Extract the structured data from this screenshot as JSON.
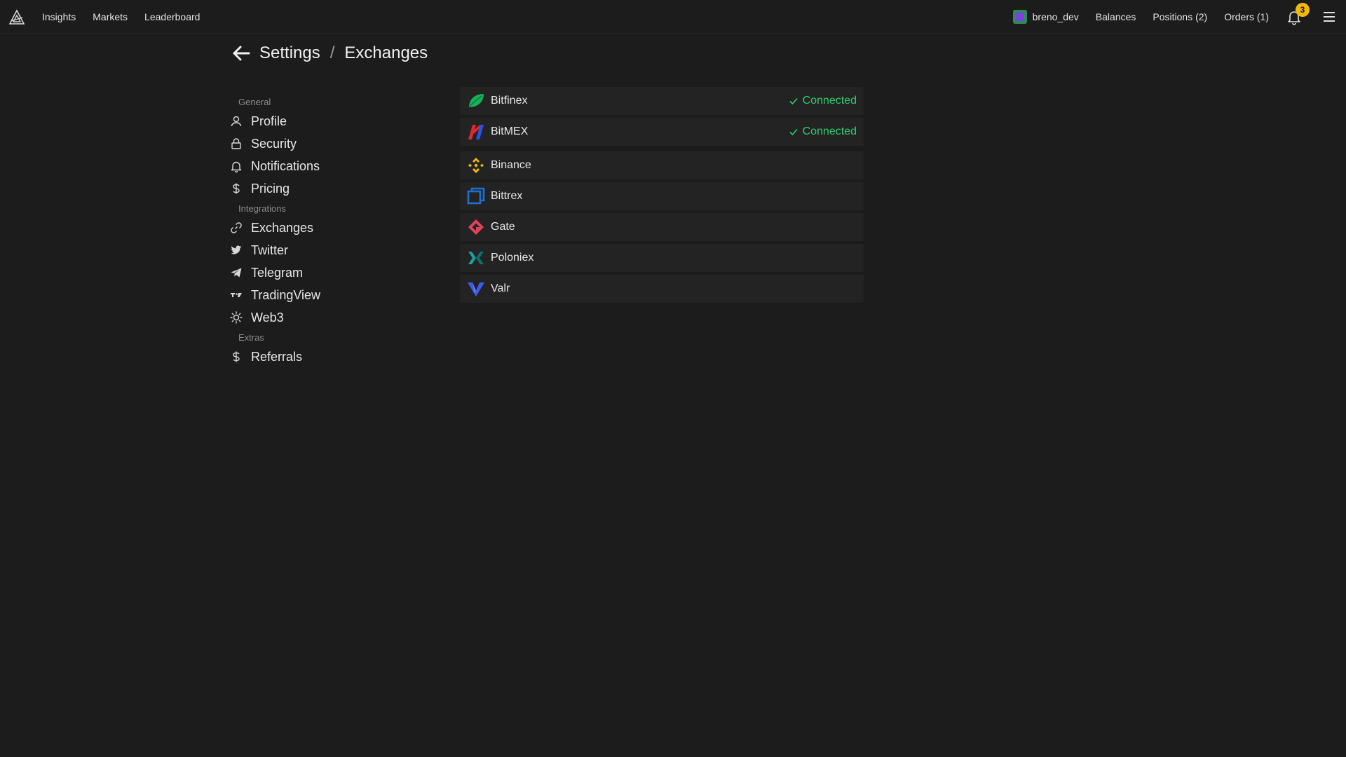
{
  "nav": {
    "links": [
      "Insights",
      "Markets",
      "Leaderboard"
    ],
    "user": "breno_dev",
    "right_links": [
      "Balances",
      "Positions (2)",
      "Orders (1)"
    ],
    "notifications_count": "3"
  },
  "page": {
    "title_parent": "Settings",
    "title_separator": "/",
    "title_current": "Exchanges"
  },
  "sidebar": {
    "general_label": "General",
    "general": [
      "Profile",
      "Security",
      "Notifications",
      "Pricing"
    ],
    "integrations_label": "Integrations",
    "integrations": [
      "Exchanges",
      "Twitter",
      "Telegram",
      "TradingView",
      "Web3"
    ],
    "extras_label": "Extras",
    "extras": [
      "Referrals"
    ]
  },
  "exchanges": [
    {
      "name": "Bitfinex",
      "status": "Connected",
      "icon": "bitfinex-icon",
      "color": "#16b157"
    },
    {
      "name": "BitMEX",
      "status": "Connected",
      "icon": "bitmex-icon",
      "color": "#e0282c"
    },
    {
      "name": "Binance",
      "status": "",
      "icon": "binance-icon",
      "color": "#f0b90b"
    },
    {
      "name": "Bittrex",
      "status": "",
      "icon": "bittrex-icon",
      "color": "#1f6fd1"
    },
    {
      "name": "Gate",
      "status": "",
      "icon": "gate-icon",
      "color": "#e0445a"
    },
    {
      "name": "Poloniex",
      "status": "",
      "icon": "poloniex-icon",
      "color": "#1aa39a"
    },
    {
      "name": "Valr",
      "status": "",
      "icon": "valr-icon",
      "color": "#3b5cf0"
    }
  ],
  "colors": {
    "background": "#1c1c1c",
    "row_background": "#232323",
    "connected": "#2ecc71",
    "badge": "#f0b90b"
  }
}
